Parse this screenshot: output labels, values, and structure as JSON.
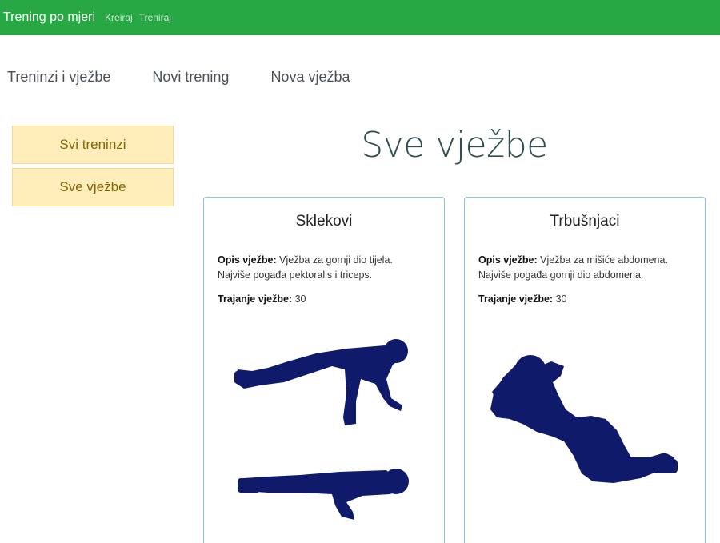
{
  "navbar": {
    "brand": "Trening po mjeri",
    "links": [
      "Kreiraj",
      "Treniraj"
    ]
  },
  "subnav": [
    "Treninzi i vježbe",
    "Novi trening",
    "Nova vježba"
  ],
  "sidebar": [
    "Svi treninzi",
    "Sve vježbe"
  ],
  "page_title": "Sve vježbe",
  "labels": {
    "description": "Opis vježbe:",
    "duration": "Trajanje vježbe:"
  },
  "exercises": [
    {
      "name": "Sklekovi",
      "desc_line1": "Vježba za gornji dio tijela.",
      "desc_line2": "Najviše pogađa pektoralis i triceps.",
      "duration": "30",
      "icon": "push-up-silhouette"
    },
    {
      "name": "Trbušnjaci",
      "desc_line1": "Vježba za mišiće abdomena.",
      "desc_line2": "Najviše pogađa gornji dio abdomena.",
      "duration": "30",
      "icon": "sit-up-silhouette"
    }
  ],
  "colors": {
    "navbar": "#28a745",
    "sidebar_button": "#ffeeba",
    "silhouette": "#0f1a6b"
  }
}
